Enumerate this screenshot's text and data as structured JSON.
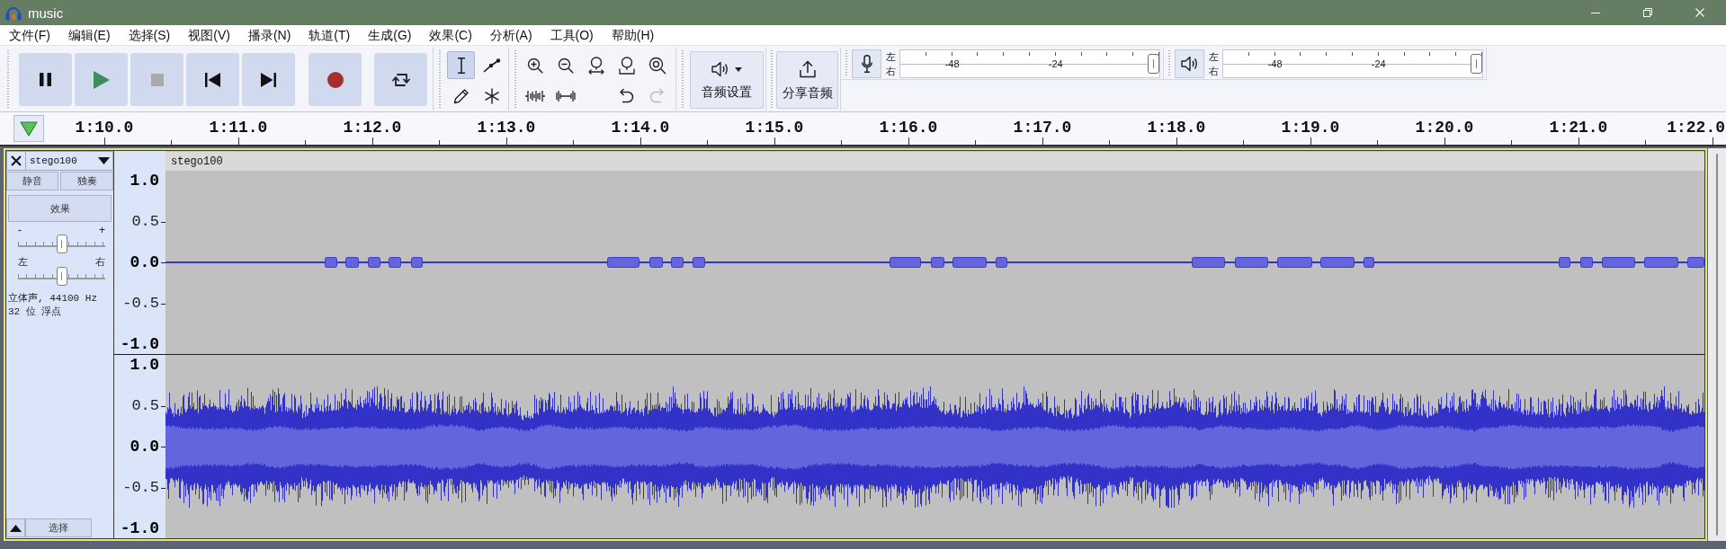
{
  "window": {
    "title": "music"
  },
  "menu": [
    "文件(F)",
    "编辑(E)",
    "选择(S)",
    "视图(V)",
    "播录(N)",
    "轨道(T)",
    "生成(G)",
    "效果(C)",
    "分析(A)",
    "工具(O)",
    "帮助(H)"
  ],
  "transport": [
    {
      "kind": "pause",
      "disabled": false
    },
    {
      "kind": "play",
      "disabled": false
    },
    {
      "kind": "stop",
      "disabled": true
    },
    {
      "kind": "skip_start",
      "disabled": false
    },
    {
      "kind": "skip_end",
      "disabled": false
    },
    {
      "kind": "record",
      "disabled": false
    },
    {
      "kind": "loop",
      "disabled": false
    }
  ],
  "tools": [
    {
      "kind": "select",
      "selected": true
    },
    {
      "kind": "envelope",
      "selected": false
    },
    {
      "kind": "draw",
      "selected": false
    },
    {
      "kind": "multi",
      "selected": false
    }
  ],
  "edit_tools": [
    {
      "kind": "zoom_in",
      "disabled": false
    },
    {
      "kind": "zoom_out",
      "disabled": false
    },
    {
      "kind": "fit_selection",
      "disabled": false
    },
    {
      "kind": "fit_project",
      "disabled": false
    },
    {
      "kind": "zoom_toggle",
      "disabled": false
    },
    {
      "kind": "trim",
      "disabled": false
    },
    {
      "kind": "silence",
      "disabled": false
    },
    {
      "kind": "undo",
      "disabled": false
    },
    {
      "kind": "redo",
      "disabled": true
    }
  ],
  "audio_setup": {
    "label": "音频设置"
  },
  "share_audio": {
    "label": "分享音频"
  },
  "meters": [
    {
      "kind": "recording",
      "channels": [
        "左",
        "右"
      ],
      "ticks": [
        "-48",
        "-24"
      ],
      "level": 1
    },
    {
      "kind": "playback",
      "channels": [
        "左",
        "右"
      ],
      "ticks": [
        "-48",
        "-24"
      ],
      "level": 1
    }
  ],
  "timeline": {
    "ticks": [
      "1:10.0",
      "1:11.0",
      "1:12.0",
      "1:13.0",
      "1:14.0",
      "1:15.0",
      "1:16.0",
      "1:17.0",
      "1:18.0",
      "1:19.0",
      "1:20.0",
      "1:21.0",
      "1:22.0"
    ]
  },
  "track": {
    "name": "stego100",
    "mute": "静音",
    "solo": "独奏",
    "effects": "效果",
    "gain": {
      "labels": [
        "-",
        "+"
      ],
      "level": 0.5
    },
    "pan": {
      "labels": [
        "左",
        "右"
      ],
      "level": 0.5
    },
    "info": [
      "立体声, 44100 Hz",
      "32 位 浮点"
    ],
    "select": "选择",
    "clip_name": "stego100",
    "channels": [
      {
        "ruler_ticks": [
          "1.0",
          "0.5",
          "0.0",
          "-0.5",
          "-1.0"
        ]
      },
      {
        "ruler_ticks": [
          "1.0",
          "0.5",
          "0.0",
          "-0.5",
          "-1.0"
        ]
      }
    ]
  }
}
